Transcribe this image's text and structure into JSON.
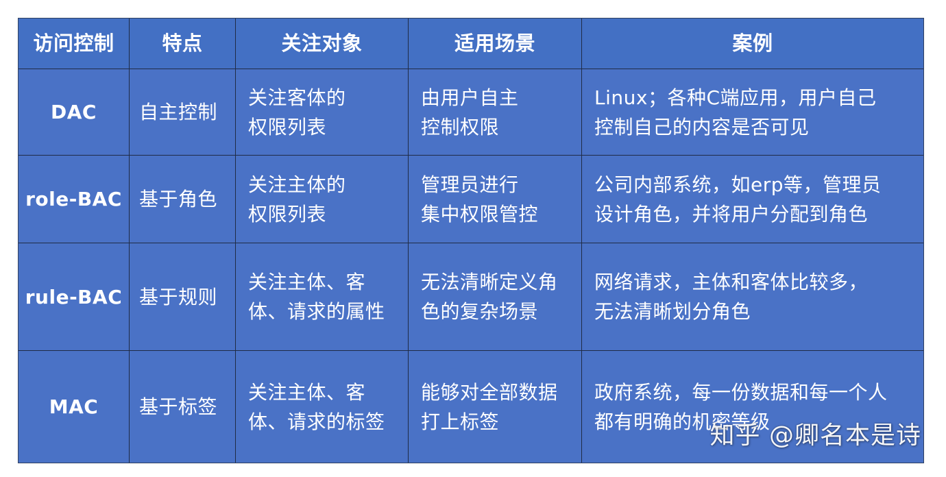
{
  "table": {
    "headers": [
      "访问控制",
      "特点",
      "关注对象",
      "适用场景",
      "案例"
    ],
    "rows": [
      {
        "name": "DAC",
        "feature": "自主控制",
        "focus": "关注客体的\n权限列表",
        "scenario": "由用户自主\n控制权限",
        "case": "Linux；各种C端应用，用户自己\n控制自己的内容是否可见"
      },
      {
        "name": "role-BAC",
        "feature": "基于角色",
        "focus": "关注主体的\n权限列表",
        "scenario": "管理员进行\n集中权限管控",
        "case": "公司内部系统，如erp等，管理员\n设计角色，并将用户分配到角色"
      },
      {
        "name": "rule-BAC",
        "feature": "基于规则",
        "focus": "关注主体、客\n体、请求的属性",
        "scenario": "无法清晰定义角\n色的复杂场景",
        "case": "网络请求，主体和客体比较多，\n无法清晰划分角色"
      },
      {
        "name": "MAC",
        "feature": "基于标签",
        "focus": "关注主体、客\n体、请求的标签",
        "scenario": "能够对全部数据\n打上标签",
        "case": "政府系统，每一份数据和每一个人\n都有明确的机密等级"
      }
    ]
  },
  "watermark": "知乎 @卿名本是诗",
  "colors": {
    "cell_bg": "#4a72c6",
    "header_bg": "#4370c4",
    "border": "#1f2b45",
    "text": "#ffffff"
  }
}
